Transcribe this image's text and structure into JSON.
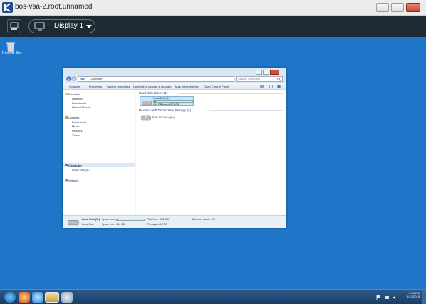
{
  "window": {
    "title": "bos-vsa-2.root.unnamed"
  },
  "toolbar": {
    "display_label": "Display 1"
  },
  "desktop": {
    "recycle_bin_label": "Recycle Bin"
  },
  "explorer": {
    "address": "Computer",
    "search_placeholder": "Search Computer",
    "commands": [
      "Organize",
      "Properties",
      "System properties",
      "Uninstall or change a program",
      "Map network drive",
      "Open Control Panel"
    ],
    "nav": {
      "favorites": "Favorites",
      "favorites_items": [
        "Desktop",
        "Downloads",
        "Recent Places"
      ],
      "libraries": "Libraries",
      "libraries_items": [
        "Documents",
        "Music",
        "Pictures",
        "Videos"
      ],
      "computer": "Computer",
      "computer_items": [
        "Local Disk (C:)"
      ],
      "network": "Network"
    },
    "groups": {
      "hdd": "Hard Disk Drives (1)",
      "removable": "Devices with Removable Storage (1)"
    },
    "drive_c": {
      "name": "Local Disk (C:)",
      "free": "484 GB free of 511 GB",
      "used_fraction": 0.05
    },
    "drive_d": {
      "name": "DVD RW Drive (D:)"
    },
    "details": {
      "name": "Local Disk (C:)",
      "type": "Local Disk",
      "space_used_label": "Space used:",
      "space_free_label": "Space free:",
      "space_free": "484 GB",
      "total_size_label": "Total size:",
      "total_size": "511 GB",
      "filesystem_label": "File system:",
      "filesystem": "NTFS",
      "bitlocker_label": "BitLocker status:",
      "bitlocker": "Off"
    }
  },
  "taskbar": {
    "clock_time": "3:36 PM",
    "clock_date": "1/13/2015"
  },
  "colors": {
    "desktop": "#1f76c8",
    "toolbar": "#1f2b33",
    "accent": "#28a4d9"
  }
}
